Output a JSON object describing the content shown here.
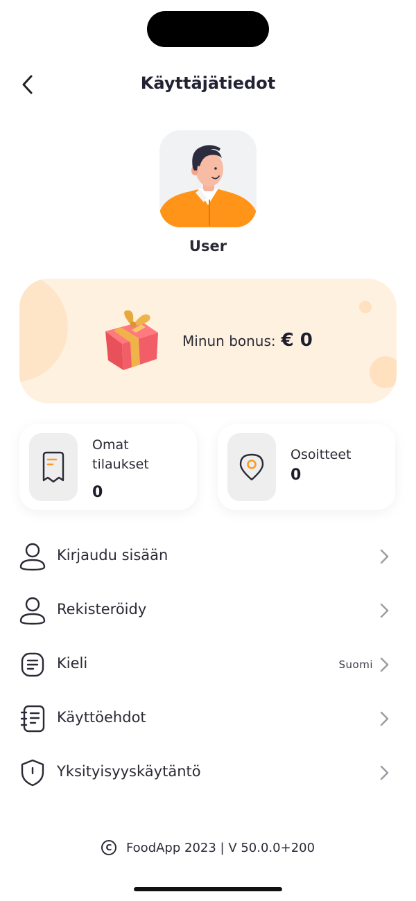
{
  "header": {
    "title": "Käyttäjätiedot"
  },
  "profile": {
    "name": "User"
  },
  "bonus": {
    "label": "Minun bonus:",
    "value": "€ 0"
  },
  "stats": {
    "orders": {
      "label": "Omat tilaukset",
      "value": "0"
    },
    "addresses": {
      "label": "Osoitteet",
      "value": "0"
    }
  },
  "menu": {
    "items": [
      {
        "label": "Kirjaudu sisään",
        "icon": "user-icon"
      },
      {
        "label": "Rekisteröidy",
        "icon": "user-icon"
      },
      {
        "label": "Kieli",
        "value": "Suomi",
        "icon": "document-icon"
      },
      {
        "label": "Käyttöehdot",
        "icon": "notebook-icon"
      },
      {
        "label": "Yksityisyyskäytäntö",
        "icon": "shield-icon"
      }
    ]
  },
  "footer": {
    "copyright_symbol": "©",
    "text": "FoodApp 2023 | V 50.0.0+200"
  },
  "colors": {
    "accent": "#FF9A1F",
    "bonus_bg": "#FFF1E0",
    "text": "#1D1D2B"
  }
}
